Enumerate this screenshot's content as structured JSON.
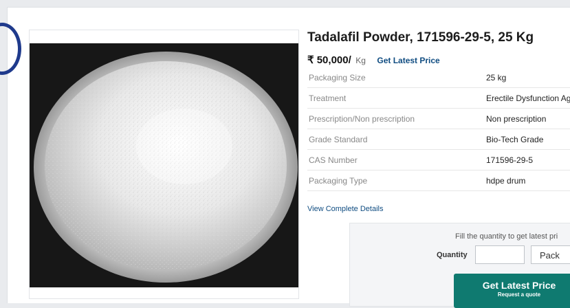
{
  "product": {
    "title": "Tadalafil Powder, 171596-29-5, 25 Kg",
    "price": "₹ 50,000/",
    "unit": "Kg",
    "get_latest_price_link": "Get Latest Price"
  },
  "specs": [
    {
      "key": "Packaging Size",
      "value": "25 kg"
    },
    {
      "key": "Treatment",
      "value": "Erectile Dysfunction Ag"
    },
    {
      "key": "Prescription/Non prescription",
      "value": "Non prescription"
    },
    {
      "key": "Grade Standard",
      "value": "Bio-Tech Grade"
    },
    {
      "key": "CAS Number",
      "value": "171596-29-5"
    },
    {
      "key": "Packaging Type",
      "value": "hdpe drum"
    }
  ],
  "view_details_link": "View Complete Details",
  "quote": {
    "fill_text": "Fill the quantity to get latest pri",
    "quantity_label": "Quantity",
    "quantity_value": "",
    "unit_selected": "Pack",
    "cta_label": "Get Latest Price",
    "cta_sub": "Request a quote"
  },
  "colors": {
    "accent_link": "#0f4c81",
    "cta_bg": "#0f7a70",
    "circle": "#1f3a8c"
  }
}
